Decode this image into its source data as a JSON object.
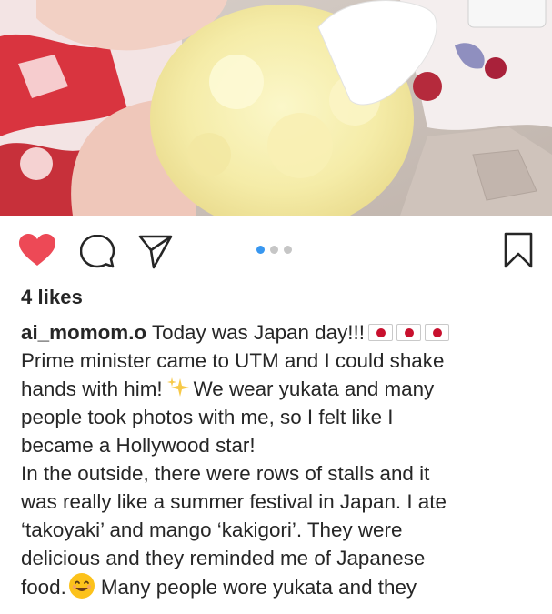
{
  "post": {
    "likes": "4 likes",
    "username": "ai_momom.o",
    "carousel": {
      "count": 3,
      "active": 0
    },
    "caption_lines": [
      "Today was Japan day!!!",
      "Prime minister came to UTM and I could shake",
      "hands with him!",
      "We wear yukata and many",
      "people took photos with me, so I felt like I",
      "became a Hollywood star!",
      "In the outside, there were rows of stalls and it",
      "was really like a summer festival in Japan. I ate",
      "‘takoyaki’ and mango ‘kakigori’. They were",
      "delicious and they reminded me of Japanese",
      "food.",
      "Many people wore yukata and they"
    ]
  },
  "icons": {
    "like": "heart-icon",
    "comment": "comment-icon",
    "share": "share-icon",
    "save": "bookmark-icon",
    "flag": "japan-flag-icon",
    "sparkles": "sparkles-icon",
    "smile": "smiling-face-icon"
  },
  "colors": {
    "heart": "#ed4956",
    "carousel_active": "#3897f0",
    "carousel_inactive": "#c6c6c6",
    "text": "#262626",
    "flag_red": "#c8102e"
  }
}
